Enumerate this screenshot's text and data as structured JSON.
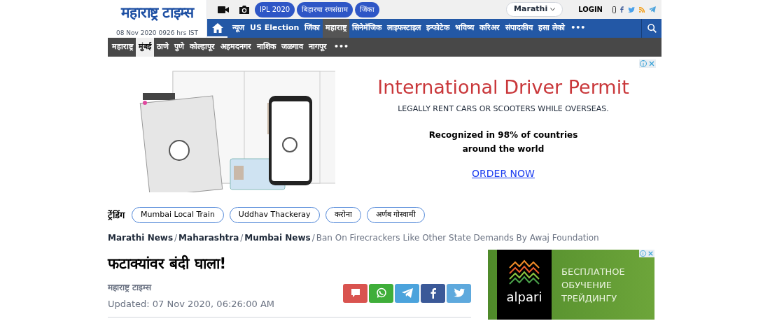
{
  "header": {
    "logo": "महाराष्ट्र टाइम्स",
    "date": "08 Nov 2020 0926 hrs IST",
    "pills": [
      "IPL 2020",
      "बिहारचा रणसंग्राम",
      "जिंका"
    ],
    "language": "Marathi",
    "login": "LOGIN"
  },
  "main_nav": [
    {
      "label": "न्यूज",
      "selected": false
    },
    {
      "label": "US Election",
      "selected": false
    },
    {
      "label": "जिंका",
      "selected": false
    },
    {
      "label": "महाराष्ट्र",
      "selected": true
    },
    {
      "label": "सिनेमॅजिक",
      "selected": false
    },
    {
      "label": "लाइफस्टाइल",
      "selected": false
    },
    {
      "label": "इन्फोटेक",
      "selected": false
    },
    {
      "label": "भविष्य",
      "selected": false
    },
    {
      "label": "करिअर",
      "selected": false
    },
    {
      "label": "संपादकीय",
      "selected": false
    },
    {
      "label": "हसा लेको",
      "selected": false
    }
  ],
  "main_nav_more": "•••",
  "sub_nav": [
    {
      "label": "महाराष्ट्र",
      "selected": false
    },
    {
      "label": "मुंबई",
      "selected": true
    },
    {
      "label": "ठाणे",
      "selected": false
    },
    {
      "label": "पुणे",
      "selected": false
    },
    {
      "label": "कोल्हापूर",
      "selected": false
    },
    {
      "label": "अहमदनगर",
      "selected": false
    },
    {
      "label": "नाशिक",
      "selected": false
    },
    {
      "label": "जळगाव",
      "selected": false
    },
    {
      "label": "नागपूर",
      "selected": false
    }
  ],
  "sub_nav_more": "•••",
  "ad": {
    "headline": "International Driver Permit",
    "subline": "LEGALLY RENT CARS OR SCOOTERS WHILE OVERSEAS.",
    "line_1": "Recognized in 98% of countries",
    "line_2": "around the world",
    "cta": "ORDER NOW"
  },
  "trending": {
    "label": "ट्रेंडिंग",
    "tags": [
      "Mumbai Local Train",
      "Uddhav Thackeray",
      "करोना",
      "अर्णब गोस्वामी"
    ]
  },
  "breadcrumbs": [
    {
      "label": "Marathi News",
      "kind": "link",
      "separator": "/"
    },
    {
      "label": "Maharashtra",
      "kind": "link",
      "separator": "/"
    },
    {
      "label": "Mumbai News",
      "kind": "link",
      "separator": "/"
    },
    {
      "label": "Ban On Firecrackers Like Other State Demands By Awaj Foundation",
      "kind": "current"
    }
  ],
  "article": {
    "title": "फटाक्यांवर बंदी घाला!",
    "source": "महाराष्ट्र टाइम्स",
    "updated": "Updated: 07 Nov 2020, 06:26:00 AM"
  },
  "share": [
    {
      "kind": "comment",
      "color": "#d9534f"
    },
    {
      "kind": "whatsapp",
      "color": "#3fae3a"
    },
    {
      "kind": "telegram",
      "color": "#4ba3dc"
    },
    {
      "kind": "facebook",
      "color": "#3b5998"
    },
    {
      "kind": "twitter",
      "color": "#5ea9dd"
    }
  ],
  "side_ad": {
    "brand": "alpari",
    "lines": [
      "БЕСПЛАТНОЕ",
      "ОБУЧЕНИЕ",
      "ТРЕЙДИНГУ"
    ]
  }
}
